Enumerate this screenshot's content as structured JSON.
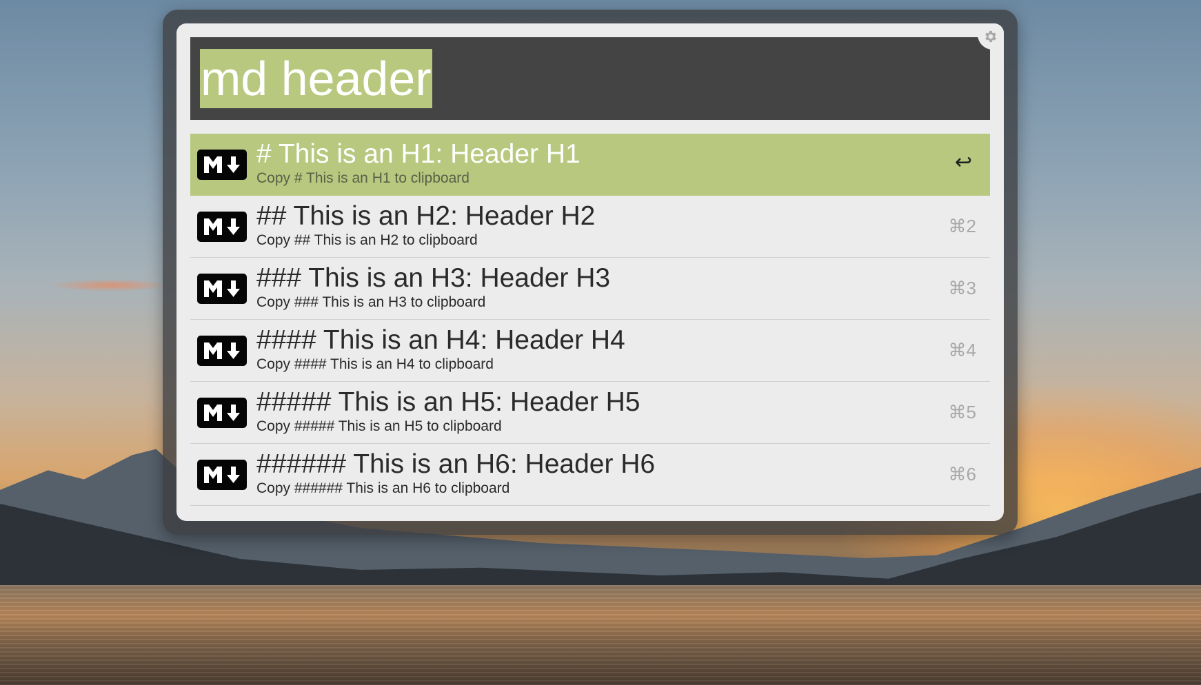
{
  "search": {
    "query": "md header"
  },
  "icons": {
    "settings": "gear-icon",
    "result": "markdown-icon"
  },
  "colors": {
    "accent": "#b8c87e",
    "search_bg": "#444444",
    "panel_bg": "#ececec"
  },
  "results": [
    {
      "title": "# This is an H1: Header H1",
      "subtitle": "Copy # This is an H1 to clipboard",
      "shortcut": "↩",
      "selected": true
    },
    {
      "title": "## This is an H2: Header H2",
      "subtitle": "Copy ## This is an H2 to clipboard",
      "shortcut": "⌘2",
      "selected": false
    },
    {
      "title": "### This is an H3: Header H3",
      "subtitle": "Copy ### This is an H3 to clipboard",
      "shortcut": "⌘3",
      "selected": false
    },
    {
      "title": "#### This is an H4: Header H4",
      "subtitle": "Copy #### This is an H4 to clipboard",
      "shortcut": "⌘4",
      "selected": false
    },
    {
      "title": "##### This is an H5: Header H5",
      "subtitle": "Copy ##### This is an H5 to clipboard",
      "shortcut": "⌘5",
      "selected": false
    },
    {
      "title": "###### This is an H6: Header H6",
      "subtitle": "Copy ###### This is an H6 to clipboard",
      "shortcut": "⌘6",
      "selected": false
    }
  ]
}
